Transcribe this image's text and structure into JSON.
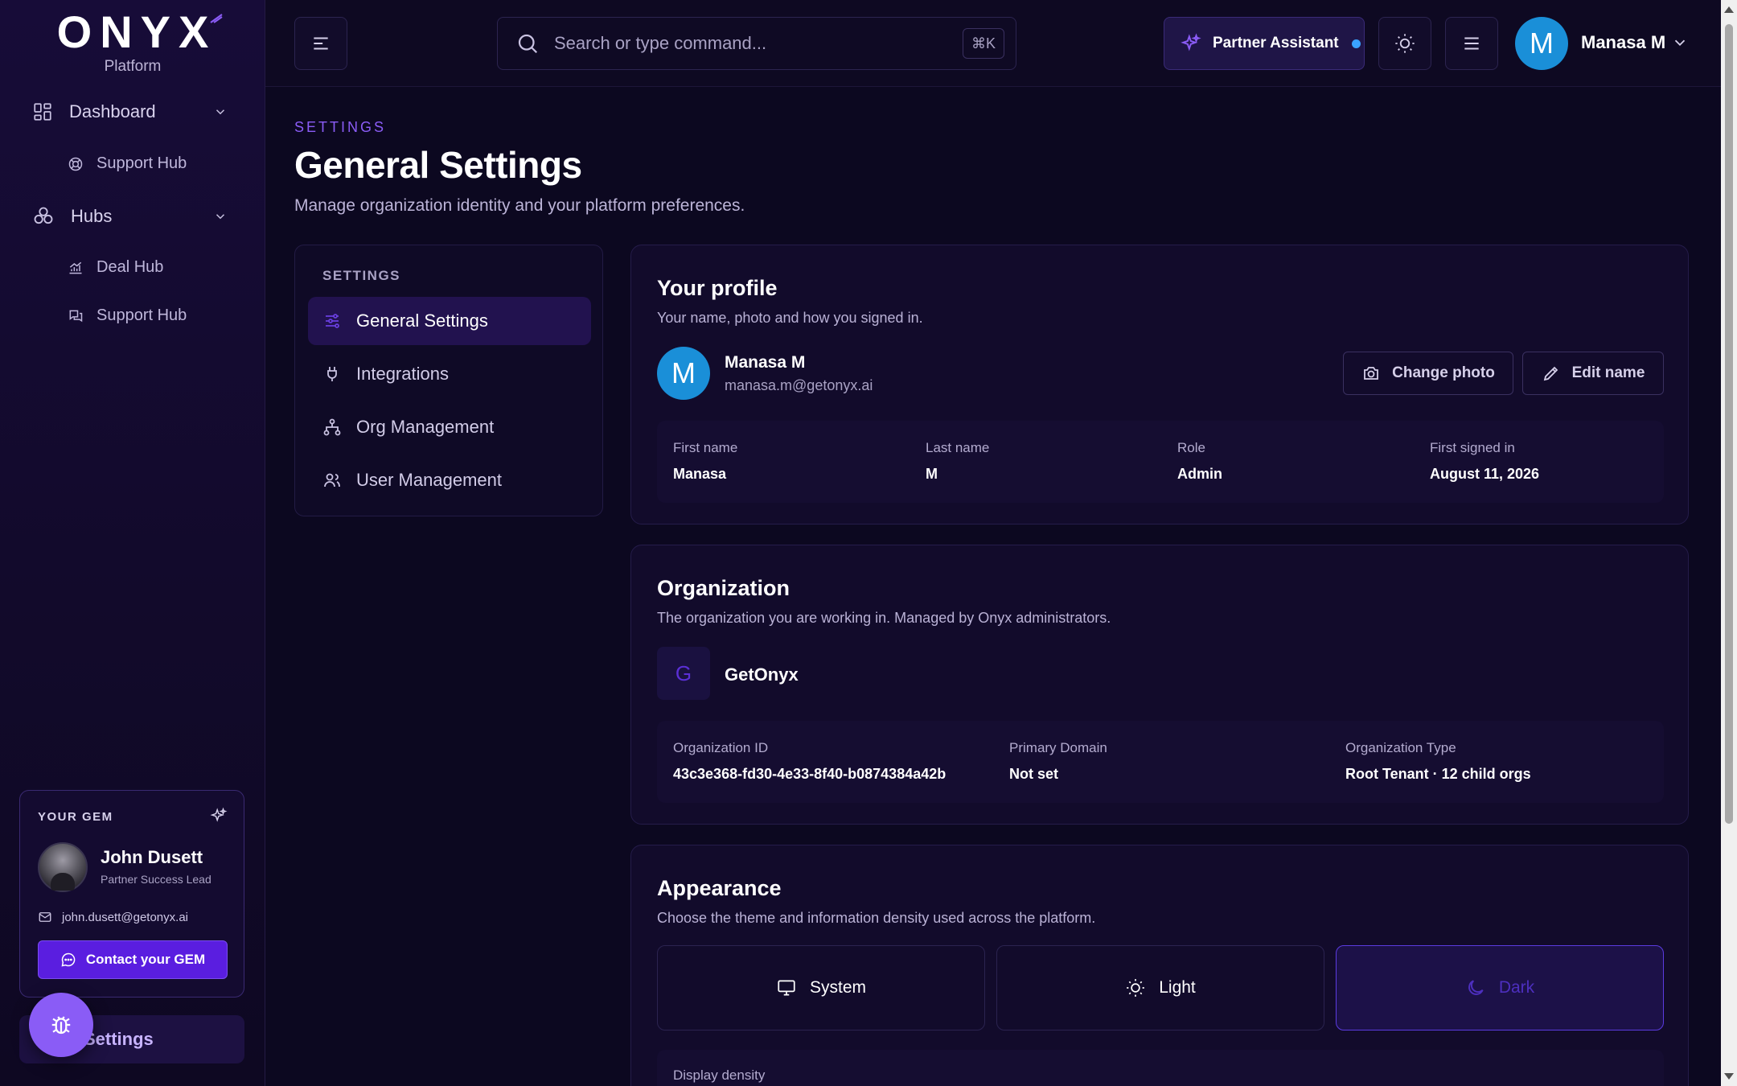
{
  "brand": {
    "logo": "ONYX",
    "subtitle": "Platform"
  },
  "sidebar": {
    "items": [
      {
        "label": "Dashboard",
        "icon": "dashboard-grid-icon"
      },
      {
        "label": "Support Hub",
        "icon": "lifebuoy-icon"
      },
      {
        "label": "Hubs",
        "icon": "hubs-cluster-icon"
      },
      {
        "label": "Deal Hub",
        "icon": "chart-up-icon"
      },
      {
        "label": "Support Hub",
        "icon": "chat-bubbles-icon"
      }
    ],
    "gem": {
      "title": "YOUR GEM",
      "name": "John Dusett",
      "role": "Partner Success Lead",
      "email": "john.dusett@getonyx.ai",
      "contact_label": "Contact your GEM"
    },
    "settings_label": "Settings"
  },
  "topbar": {
    "search_placeholder": "Search or type command...",
    "shortcut": "⌘K",
    "partner_assistant": "Partner Assistant",
    "user_initial": "M",
    "user_name": "Manasa M"
  },
  "page": {
    "eyebrow": "SETTINGS",
    "title": "General Settings",
    "subtitle": "Manage organization identity and your platform preferences."
  },
  "settings_menu": {
    "heading": "SETTINGS",
    "items": [
      {
        "label": "General Settings",
        "icon": "sliders-icon",
        "active": true
      },
      {
        "label": "Integrations",
        "icon": "plug-icon",
        "active": false
      },
      {
        "label": "Org Management",
        "icon": "org-tree-icon",
        "active": false
      },
      {
        "label": "User Management",
        "icon": "users-icon",
        "active": false
      }
    ]
  },
  "profile": {
    "title": "Your profile",
    "description": "Your name, photo and how you signed in.",
    "initial": "M",
    "name": "Manasa M",
    "email": "manasa.m@getonyx.ai",
    "change_photo": "Change photo",
    "edit_name": "Edit name",
    "fields": [
      {
        "label": "First name",
        "value": "Manasa"
      },
      {
        "label": "Last name",
        "value": "M"
      },
      {
        "label": "Role",
        "value": "Admin"
      },
      {
        "label": "First signed in",
        "value": "August 11, 2026"
      }
    ]
  },
  "organization": {
    "title": "Organization",
    "description": "The organization you are working in. Managed by Onyx administrators.",
    "logo_initial": "G",
    "name": "GetOnyx",
    "fields": [
      {
        "label": "Organization ID",
        "value": "43c3e368-fd30-4e33-8f40-b0874384a42b"
      },
      {
        "label": "Primary Domain",
        "value": "Not set"
      },
      {
        "label": "Organization Type",
        "value": "Root Tenant · 12 child orgs"
      }
    ]
  },
  "appearance": {
    "title": "Appearance",
    "description": "Choose the theme and information density used across the platform.",
    "themes": [
      {
        "label": "System",
        "icon": "monitor-icon"
      },
      {
        "label": "Light",
        "icon": "sun-icon"
      },
      {
        "label": "Dark",
        "icon": "moon-icon",
        "selected": true
      }
    ],
    "density_label": "Display density"
  },
  "colors": {
    "accent": "#8b5cf6",
    "primary_button": "#5a1ee0",
    "avatar": "#1a8fd8",
    "background": "#0c0820"
  }
}
